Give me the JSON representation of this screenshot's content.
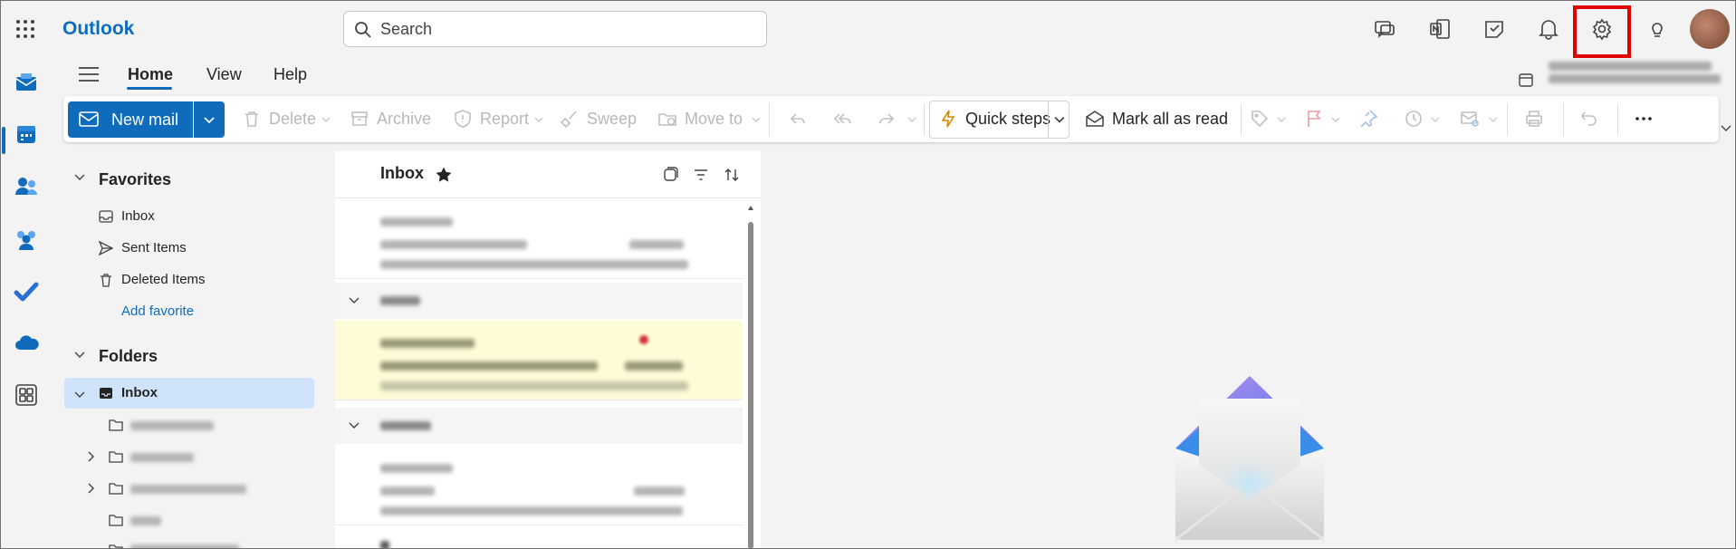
{
  "app": {
    "title": "Outlook"
  },
  "search": {
    "placeholder": "Search"
  },
  "tabs": [
    {
      "label": "Home",
      "active": true
    },
    {
      "label": "View",
      "active": false
    },
    {
      "label": "Help",
      "active": false
    }
  ],
  "ribbon": {
    "new_mail": "New mail",
    "delete": "Delete",
    "archive": "Archive",
    "report": "Report",
    "sweep": "Sweep",
    "move_to": "Move to",
    "quick_steps": "Quick steps",
    "mark_all_read": "Mark all as read"
  },
  "folders_pane": {
    "favorites_label": "Favorites",
    "favorites": [
      {
        "label": "Inbox",
        "icon": "inbox-icon"
      },
      {
        "label": "Sent Items",
        "icon": "send-icon"
      },
      {
        "label": "Deleted Items",
        "icon": "trash-icon"
      }
    ],
    "add_favorite": "Add favorite",
    "folders_label": "Folders",
    "inbox": "Inbox"
  },
  "message_list": {
    "title": "Inbox"
  },
  "colors": {
    "accent": "#0f6cbd",
    "selection": "#cfe4fa",
    "highlight_box": "#e00000",
    "unread_row": "#fefcd6"
  }
}
